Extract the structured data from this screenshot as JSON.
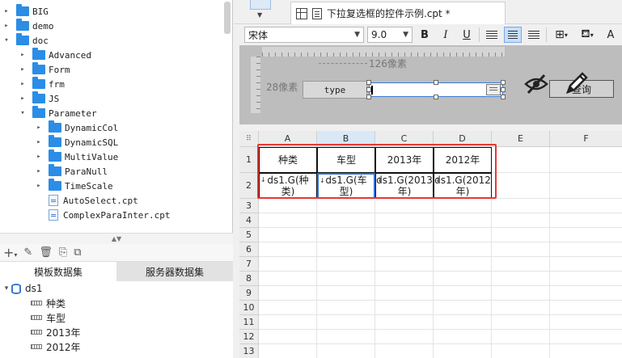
{
  "tree": {
    "items": [
      {
        "label": "BIG",
        "level": 0,
        "expanded": false,
        "kind": "folder"
      },
      {
        "label": "demo",
        "level": 0,
        "expanded": false,
        "kind": "folder"
      },
      {
        "label": "doc",
        "level": 0,
        "expanded": true,
        "kind": "folder"
      },
      {
        "label": "Advanced",
        "level": 1,
        "expanded": false,
        "kind": "folder"
      },
      {
        "label": "Form",
        "level": 1,
        "expanded": false,
        "kind": "folder"
      },
      {
        "label": "frm",
        "level": 1,
        "expanded": false,
        "kind": "folder"
      },
      {
        "label": "JS",
        "level": 1,
        "expanded": false,
        "kind": "folder"
      },
      {
        "label": "Parameter",
        "level": 1,
        "expanded": true,
        "kind": "folder"
      },
      {
        "label": "DynamicCol",
        "level": 2,
        "expanded": false,
        "kind": "folder"
      },
      {
        "label": "DynamicSQL",
        "level": 2,
        "expanded": false,
        "kind": "folder"
      },
      {
        "label": "MultiValue",
        "level": 2,
        "expanded": false,
        "kind": "folder"
      },
      {
        "label": "ParaNull",
        "level": 2,
        "expanded": false,
        "kind": "folder"
      },
      {
        "label": "TimeScale",
        "level": 2,
        "expanded": false,
        "kind": "folder"
      },
      {
        "label": "AutoSelect.cpt",
        "level": 2,
        "kind": "file"
      },
      {
        "label": "ComplexParaInter.cpt",
        "level": 2,
        "kind": "file"
      }
    ]
  },
  "dataset_tabs": {
    "template": "模板数据集",
    "server": "服务器数据集"
  },
  "dataset": {
    "name": "ds1",
    "fields": [
      "种类",
      "车型",
      "2013年",
      "2012年"
    ]
  },
  "document": {
    "tab_title": "下拉复选框的控件示例.cpt *"
  },
  "format": {
    "font_name": "宋体",
    "font_size": "9.0",
    "bold": "B",
    "italic": "I",
    "underline": "U"
  },
  "param_pane": {
    "width_label": "126像素",
    "height_label": "28像素",
    "type_label": "type",
    "query_label": "查询"
  },
  "sheet": {
    "corner": "⠿",
    "columns": [
      "A",
      "B",
      "C",
      "D",
      "E",
      "F"
    ],
    "rows": [
      "1",
      "2",
      "3",
      "4",
      "5",
      "6",
      "7",
      "8",
      "9",
      "10",
      "11",
      "12",
      "13"
    ],
    "header_cells": [
      "种类",
      "车型",
      "2013年",
      "2012年"
    ],
    "data_cells": [
      "ds1.G(种类)",
      "ds1.G(车型)",
      "ds1.G(2013年)",
      "ds1.G(2012年)"
    ]
  },
  "colors": {
    "accent": "#2e6fd6",
    "highlight": "#e53935",
    "folder": "#2b8de6"
  }
}
